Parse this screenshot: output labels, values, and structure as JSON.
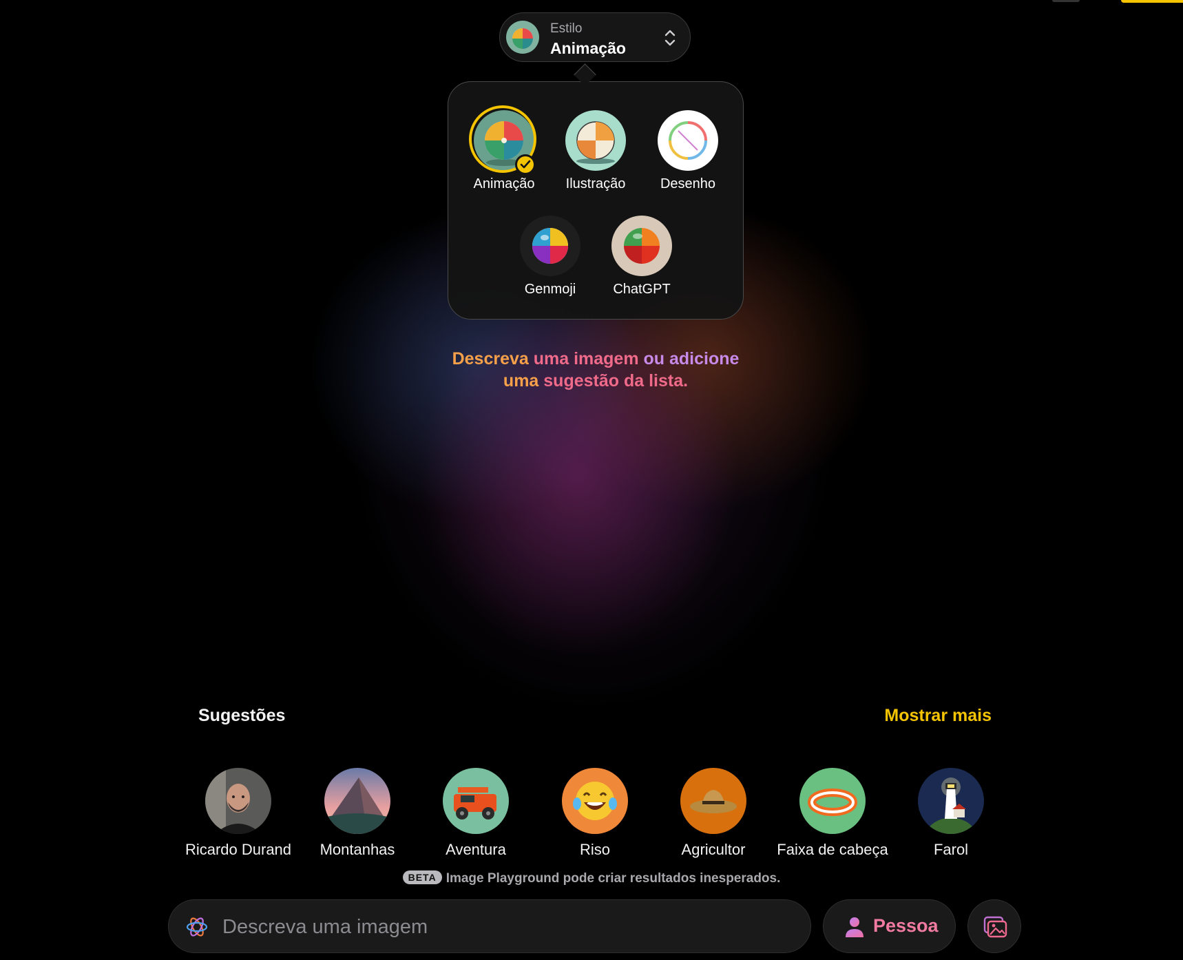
{
  "style_selector": {
    "caption": "Estilo",
    "value": "Animação"
  },
  "style_options": [
    {
      "label": "Animação",
      "selected": true,
      "icon": "beach-ball-animation"
    },
    {
      "label": "Ilustração",
      "selected": false,
      "icon": "beach-ball-illustration"
    },
    {
      "label": "Desenho",
      "selected": false,
      "icon": "beach-ball-sketch"
    },
    {
      "label": "Genmoji",
      "selected": false,
      "icon": "beach-ball-genmoji"
    },
    {
      "label": "ChatGPT",
      "selected": false,
      "icon": "beach-ball-chatgpt"
    }
  ],
  "hint": {
    "part1": "Descreva ",
    "part2": "uma imagem ",
    "part3": "ou adicione",
    "part4": "uma ",
    "part5": "sugestão da lista."
  },
  "suggestions": {
    "title": "Sugestões",
    "show_more": "Mostrar mais",
    "items": [
      {
        "label": "Ricardo Durand",
        "icon": "person-photo"
      },
      {
        "label": "Montanhas",
        "icon": "mountain"
      },
      {
        "label": "Aventura",
        "icon": "jeep"
      },
      {
        "label": "Riso",
        "icon": "laughing-emoji"
      },
      {
        "label": "Agricultor",
        "icon": "straw-hat"
      },
      {
        "label": "Faixa de cabeça",
        "icon": "headband"
      },
      {
        "label": "Farol",
        "icon": "lighthouse"
      }
    ]
  },
  "beta": {
    "badge": "BETA",
    "text": "Image Playground pode criar resultados inesperados."
  },
  "prompt": {
    "placeholder": "Descreva uma imagem"
  },
  "person_button": {
    "label": "Pessoa"
  },
  "colors": {
    "accent": "#f5c400",
    "hint_orange": "#f7a04a",
    "hint_pink": "#f06a8a",
    "hint_purple": "#c88ae8",
    "person_pink": "#f07aa0"
  }
}
